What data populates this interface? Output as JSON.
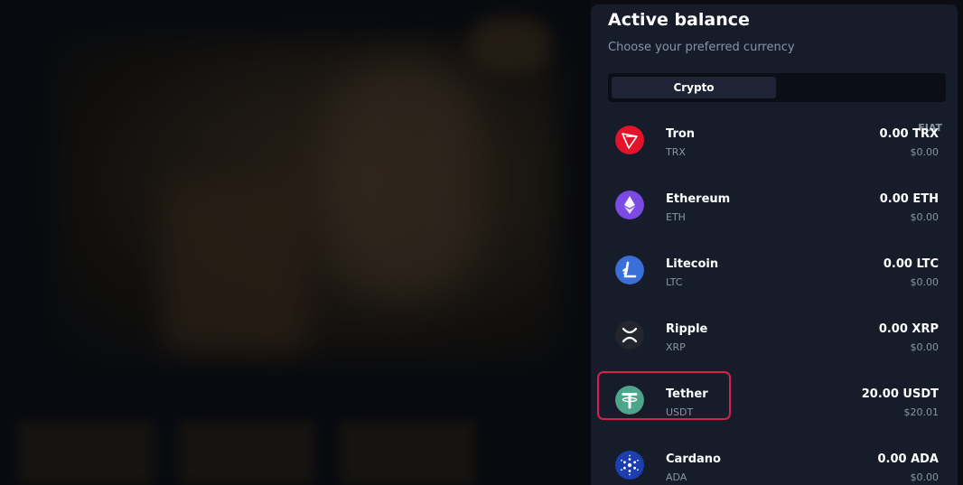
{
  "panel": {
    "title": "Active balance",
    "subtitle": "Choose your preferred currency",
    "tabs": [
      {
        "label": "Crypto",
        "active": true
      },
      {
        "label": "FIAT",
        "active": false
      }
    ]
  },
  "coins": [
    {
      "name": "Tron",
      "symbol": "TRX",
      "amount": "0.00 TRX",
      "fiat": "$0.00",
      "icon": "tron-icon",
      "color": "#e2132a"
    },
    {
      "name": "Ethereum",
      "symbol": "ETH",
      "amount": "0.00 ETH",
      "fiat": "$0.00",
      "icon": "ethereum-icon",
      "color": "#7b4ae2"
    },
    {
      "name": "Litecoin",
      "symbol": "LTC",
      "amount": "0.00 LTC",
      "fiat": "$0.00",
      "icon": "litecoin-icon",
      "color": "#3a6fd8"
    },
    {
      "name": "Ripple",
      "symbol": "XRP",
      "amount": "0.00 XRP",
      "fiat": "$0.00",
      "icon": "ripple-icon",
      "color": "#23262e"
    },
    {
      "name": "Tether",
      "symbol": "USDT",
      "amount": "20.00 USDT",
      "fiat": "$20.01",
      "icon": "tether-icon",
      "color": "#4fa58a",
      "highlighted": true
    },
    {
      "name": "Cardano",
      "symbol": "ADA",
      "amount": "0.00 ADA",
      "fiat": "$0.00",
      "icon": "cardano-icon",
      "color": "#1b3fb0"
    }
  ],
  "colors": {
    "panel_bg": "#171c2b",
    "highlight_border": "#d8204a",
    "muted_text": "#8b93a8"
  }
}
